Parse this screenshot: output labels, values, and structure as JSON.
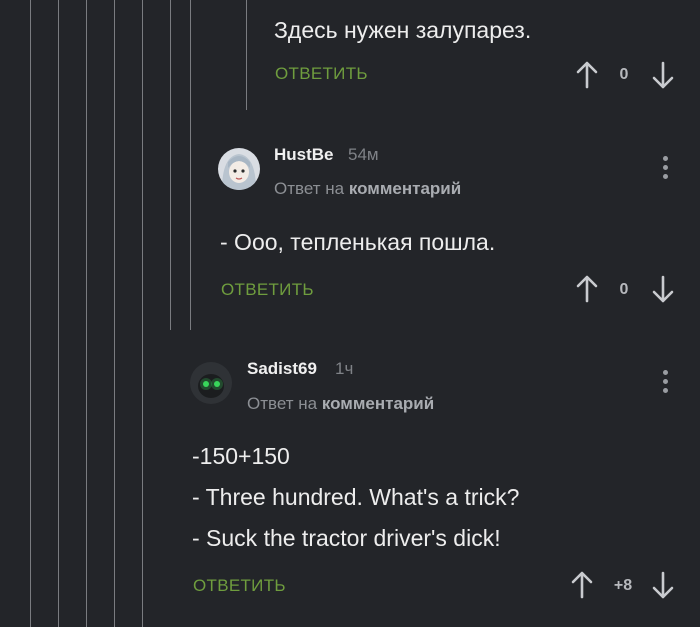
{
  "comments": [
    {
      "body": [
        "Здесь нужен залупарез."
      ],
      "reply_label": "ОТВЕТИТЬ",
      "score": "0"
    },
    {
      "username": "HustBe",
      "time": "54м",
      "reply_to_prefix": "Ответ на",
      "reply_to_link": "комментарий",
      "body": [
        "- Ооо, тепленькая пошла."
      ],
      "reply_label": "ОТВЕТИТЬ",
      "score": "0"
    },
    {
      "username": "Sadist69",
      "time": "1ч",
      "reply_to_prefix": "Ответ на",
      "reply_to_link": "комментарий",
      "body": [
        "-150+150",
        "- Three hundred. What's a trick?",
        "- Suck the tractor driver's dick!"
      ],
      "reply_label": "ОТВЕТИТЬ",
      "score": "+8"
    }
  ],
  "colors": {
    "background": "#232529",
    "reply_green": "#6f9d3e",
    "thread_line": "#7a7c80"
  },
  "icons": {
    "upvote": "arrow-up-icon",
    "downvote": "arrow-down-icon",
    "menu": "more-vertical-icon"
  }
}
